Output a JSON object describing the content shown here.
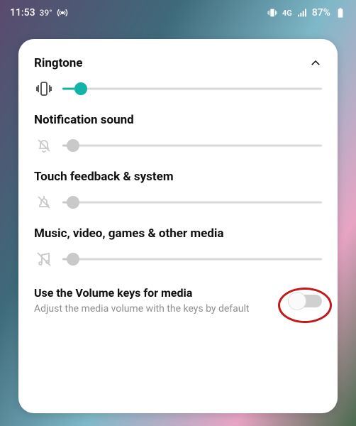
{
  "status": {
    "time": "11:53",
    "temp": "39°",
    "network_label": "4G",
    "battery": "87%"
  },
  "sections": {
    "ringtone": {
      "title": "Ringtone",
      "value_pct": 7
    },
    "notification": {
      "title": "Notification sound",
      "value_pct": 4
    },
    "touch": {
      "title": "Touch feedback & system",
      "value_pct": 4
    },
    "media": {
      "title": "Music, video, games & other media",
      "value_pct": 4
    }
  },
  "toggle": {
    "title": "Use the Volume keys for media",
    "desc": "Adjust the media volume with the keys by default",
    "on": false
  }
}
